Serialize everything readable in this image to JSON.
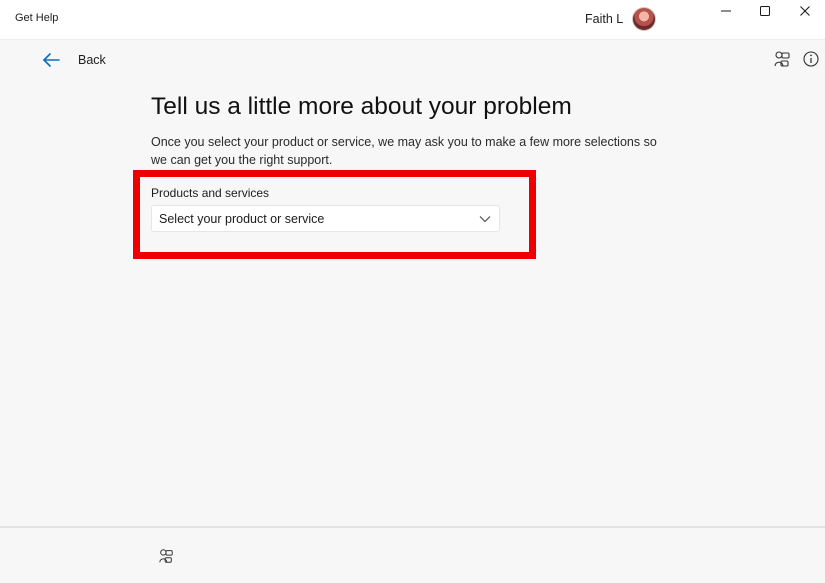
{
  "titlebar": {
    "app_title": "Get Help",
    "user_name": "Faith L"
  },
  "nav": {
    "back_label": "Back"
  },
  "main": {
    "heading": "Tell us a little more about your problem",
    "description": "Once you select your product or service, we may ask you to make a few more selections so we can get you the right support.",
    "products_field": {
      "label": "Products and services",
      "placeholder": "Select your product or service"
    }
  },
  "colors": {
    "accent_blue": "#0f6cbd",
    "highlight_red": "#ee0000",
    "background": "#f7f7f7"
  },
  "icons": {
    "back": "arrow-left-icon",
    "feedback": "feedback-icon",
    "info": "info-icon",
    "footer": "feedback-icon"
  }
}
